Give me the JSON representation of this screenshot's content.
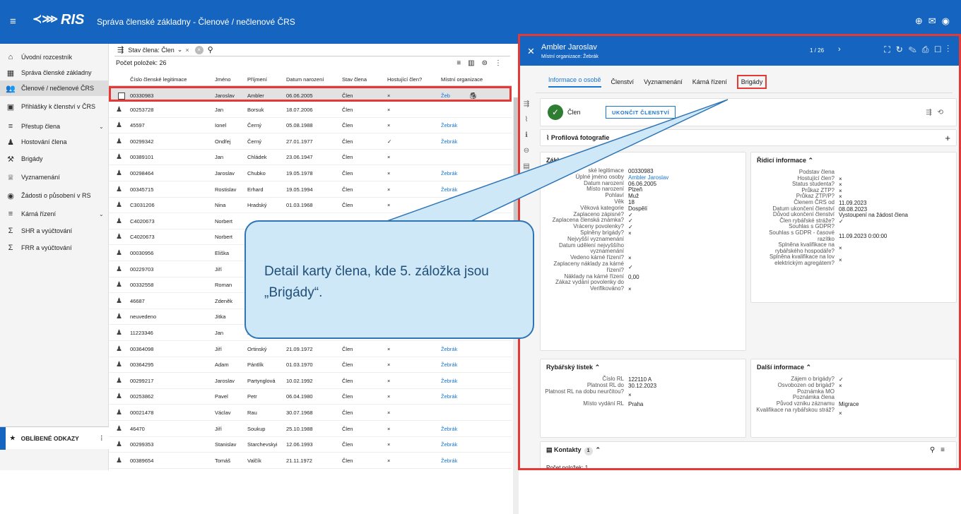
{
  "topbar": {
    "logo": "RIS",
    "title": "Správa členské základny - Členové / nečlenové ČRS"
  },
  "sidebar": {
    "items": [
      {
        "label": "Úvodní rozcestník",
        "icon": "home-icon",
        "glyph": "⌂",
        "chevron": ""
      },
      {
        "label": "Správa členské základny",
        "icon": "grid-icon",
        "glyph": "▦",
        "chevron": ""
      },
      {
        "label": "Členové / nečlenové ČRS",
        "icon": "people-icon",
        "glyph": "👥",
        "chevron": ""
      },
      {
        "label": "Přihlášky k členství v ČRS",
        "icon": "form-icon",
        "glyph": "▣",
        "chevron": ""
      },
      {
        "label": "Přestup člena",
        "icon": "list-icon",
        "glyph": "≡",
        "chevron": "⌄"
      },
      {
        "label": "Hostování člena",
        "icon": "guest-icon",
        "glyph": "♟",
        "chevron": ""
      },
      {
        "label": "Brigády",
        "icon": "worker-icon",
        "glyph": "⚒",
        "chevron": ""
      },
      {
        "label": "Vyznamenání",
        "icon": "trophy-icon",
        "glyph": "♕",
        "chevron": ""
      },
      {
        "label": "Žádosti o působení v RS",
        "icon": "request-icon",
        "glyph": "◉",
        "chevron": ""
      },
      {
        "label": "Kárná řízení",
        "icon": "list-icon",
        "glyph": "≡",
        "chevron": "⌄"
      },
      {
        "label": "SHR a vyúčtování",
        "icon": "sum-icon",
        "glyph": "Σ",
        "chevron": ""
      },
      {
        "label": "FRR a vyúčtování",
        "icon": "sum-icon",
        "glyph": "Σ",
        "chevron": ""
      }
    ],
    "favorites_label": "OBLÍBENÉ ODKAZY"
  },
  "list": {
    "filter_chip": "Stav člena: Člen",
    "count_label": "Počet položek: 26",
    "columns": [
      "Číslo členské legitimace",
      "Jméno",
      "Příjmení",
      "Datum narození",
      "Stav člena",
      "Hostující člen?",
      "Místní organizace"
    ],
    "rows": [
      {
        "id": "00330983",
        "first": "Jaroslav",
        "last": "Ambler",
        "born": "06.06.2005",
        "status": "Člen",
        "guest": "×",
        "org": "Žeb"
      },
      {
        "id": "00253728",
        "first": "Jan",
        "last": "Borsuk",
        "born": "18.07.2006",
        "status": "Člen",
        "guest": "×",
        "org": ""
      },
      {
        "id": "45597",
        "first": "Ionel",
        "last": "Černý",
        "born": "05.08.1988",
        "status": "Člen",
        "guest": "×",
        "org": "Žebrák"
      },
      {
        "id": "00299342",
        "first": "Ondřej",
        "last": "Černý",
        "born": "27.01.1977",
        "status": "Člen",
        "guest": "✓",
        "org": "Žebrák"
      },
      {
        "id": "00389101",
        "first": "Jan",
        "last": "Chládek",
        "born": "23.06.1947",
        "status": "Člen",
        "guest": "×",
        "org": ""
      },
      {
        "id": "00298464",
        "first": "Jaroslav",
        "last": "Chubko",
        "born": "19.05.1978",
        "status": "Člen",
        "guest": "×",
        "org": "Žebrák"
      },
      {
        "id": "00345715",
        "first": "Rostislav",
        "last": "Erhard",
        "born": "19.05.1994",
        "status": "Člen",
        "guest": "×",
        "org": "Žebrák"
      },
      {
        "id": "C3031206",
        "first": "Nina",
        "last": "Hradský",
        "born": "01.03.1968",
        "status": "Člen",
        "guest": "×",
        "org": ""
      },
      {
        "id": "C4020673",
        "first": "Norbert",
        "last": "",
        "born": "",
        "status": "",
        "guest": "",
        "org": ""
      },
      {
        "id": "C4020673",
        "first": "Norbert",
        "last": "",
        "born": "",
        "status": "",
        "guest": "",
        "org": ""
      },
      {
        "id": "00030956",
        "first": "Eliška",
        "last": "",
        "born": "",
        "status": "",
        "guest": "",
        "org": ""
      },
      {
        "id": "00229703",
        "first": "Jiří",
        "last": "",
        "born": "",
        "status": "",
        "guest": "",
        "org": ""
      },
      {
        "id": "00332558",
        "first": "Roman",
        "last": "",
        "born": "",
        "status": "",
        "guest": "",
        "org": ""
      },
      {
        "id": "46687",
        "first": "Zdeněk",
        "last": "",
        "born": "",
        "status": "",
        "guest": "",
        "org": ""
      },
      {
        "id": "neuvedeno",
        "first": "Jitka",
        "last": "",
        "born": "",
        "status": "",
        "guest": "",
        "org": ""
      },
      {
        "id": "11223346",
        "first": "Jan",
        "last": "Nov",
        "born": "",
        "status": "",
        "guest": "",
        "org": ""
      },
      {
        "id": "00364098",
        "first": "Jiří",
        "last": "Ortinský",
        "born": "21.09.1972",
        "status": "Člen",
        "guest": "×",
        "org": "Žebrák"
      },
      {
        "id": "00364295",
        "first": "Adam",
        "last": "Pántlík",
        "born": "01.03.1970",
        "status": "Člen",
        "guest": "×",
        "org": "Žebrák"
      },
      {
        "id": "00299217",
        "first": "Jaroslav",
        "last": "Partynglová",
        "born": "10.02.1992",
        "status": "Člen",
        "guest": "×",
        "org": "Žebrák"
      },
      {
        "id": "00253862",
        "first": "Pavel",
        "last": "Petr",
        "born": "06.04.1980",
        "status": "Člen",
        "guest": "×",
        "org": "Žebrák"
      },
      {
        "id": "00021478",
        "first": "Václav",
        "last": "Rau",
        "born": "30.07.1968",
        "status": "Člen",
        "guest": "×",
        "org": ""
      },
      {
        "id": "46470",
        "first": "Jiří",
        "last": "Soukup",
        "born": "25.10.1988",
        "status": "Člen",
        "guest": "×",
        "org": "Žebrák"
      },
      {
        "id": "00299353",
        "first": "Stanislav",
        "last": "Starchevskyi",
        "born": "12.06.1993",
        "status": "Člen",
        "guest": "×",
        "org": "Žebrák"
      },
      {
        "id": "00389654",
        "first": "Tomáš",
        "last": "Valčík",
        "born": "21.11.1972",
        "status": "Člen",
        "guest": "×",
        "org": "Žebrák"
      }
    ]
  },
  "detail": {
    "name": "Ambler Jaroslav",
    "org": "Místní organizace: Žebrák",
    "pager": "1 / 26",
    "tabs": [
      "Informace o osobě",
      "Členství",
      "Vyznamenání",
      "Kárná řízení",
      "Brigády"
    ],
    "status_label": "Člen",
    "end_button": "UKONČIT ČLENSTVÍ",
    "photo_title": "Profilová fotografie",
    "basic_title": "Základní",
    "basic": [
      {
        "k": "ské legitimace",
        "v": "00330983"
      },
      {
        "k": "Úplné jméno osoby",
        "v": "Ambler Jaroslav"
      },
      {
        "k": "Datum narození",
        "v": "06.06.2005"
      },
      {
        "k": "Místo narození",
        "v": "Plzeň"
      },
      {
        "k": "Pohlaví",
        "v": "Muž"
      },
      {
        "k": "Věk",
        "v": "18"
      },
      {
        "k": "Věková kategorie",
        "v": "Dospělí"
      },
      {
        "k": "Zaplaceno zápisné?",
        "v": "✓"
      },
      {
        "k": "Zaplacena členská známka?",
        "v": "✓"
      },
      {
        "k": "Vráceny povolenky?",
        "v": "✓"
      },
      {
        "k": "Splněny brigády?",
        "v": "×"
      },
      {
        "k": "Nejvyšší vyznamenání",
        "v": ""
      },
      {
        "k": "Datum udělení nejvyššího vyznamenání",
        "v": ""
      },
      {
        "k": "Vedeno kárné řízení?",
        "v": "×"
      },
      {
        "k": "Zaplaceny náklady za kárné řízení?",
        "v": "✓"
      },
      {
        "k": "Náklady na kárné řízení",
        "v": "0,00"
      },
      {
        "k": "Zákaz vydání povolenky do",
        "v": ""
      },
      {
        "k": "Verifikováno?",
        "v": "×"
      }
    ],
    "control_title": "Řídicí informace",
    "control": [
      {
        "k": "Podstav člena",
        "v": ""
      },
      {
        "k": "Hostující člen?",
        "v": "×"
      },
      {
        "k": "Status studenta?",
        "v": "×"
      },
      {
        "k": "Průkaz ZTP?",
        "v": "×"
      },
      {
        "k": "Průkaz ZTP/P?",
        "v": "×"
      },
      {
        "k": "Členem ČRS od",
        "v": "11.09.2023"
      },
      {
        "k": "Datum ukončení členství",
        "v": "08.08.2023"
      },
      {
        "k": "Důvod ukončení členství",
        "v": "Vystoupení na žádost člena"
      },
      {
        "k": "Člen rybářské stráže?",
        "v": "✓"
      },
      {
        "k": "Souhlas s GDPR?",
        "v": ""
      },
      {
        "k": "Souhlas s GDPR - časové razítko",
        "v": "11.09.2023 0:00:00"
      },
      {
        "k": "Splněna kvalifikace na rybářského hospodáře?",
        "v": "×"
      },
      {
        "k": "Splněna kvalifikace na lov elektrickým agregátem?",
        "v": "×"
      }
    ],
    "fishing_title": "Rybářský lístek",
    "fishing": [
      {
        "k": "Číslo RL",
        "v": "122110 A"
      },
      {
        "k": "Platnost RL do",
        "v": "30.12.2023"
      },
      {
        "k": "Platnost RL na dobu neurčitou?",
        "v": "×"
      },
      {
        "k": "Místo vydání RL",
        "v": "Praha"
      }
    ],
    "more_title": "Další informace",
    "more": [
      {
        "k": "Zájem o brigády?",
        "v": "✓"
      },
      {
        "k": "Osvobozen od brigád?",
        "v": "×"
      },
      {
        "k": "Poznámka MO",
        "v": ""
      },
      {
        "k": "Poznámka člena",
        "v": ""
      },
      {
        "k": "Původ vzniku záznamu",
        "v": "Migrace"
      },
      {
        "k": "Kvalifikace na rybářskou stráž?",
        "v": "×"
      }
    ],
    "contacts_title": "Kontakty",
    "contacts_badge": "1",
    "contacts_count": "Počet položek: 1"
  },
  "callout": {
    "text": "Detail karty člena, kde 5. záložka jsou „Brigády“."
  },
  "colors": {
    "brand": "#1565c0",
    "highlight": "#e53935",
    "link": "#1976d2"
  }
}
